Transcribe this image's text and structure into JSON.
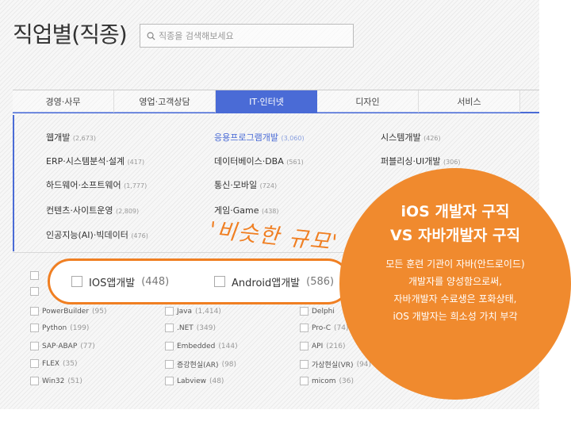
{
  "header": {
    "title": "직업별(직종)",
    "search_placeholder": "직종을 검색해보세요",
    "search_icon": "search-icon"
  },
  "tabs": [
    {
      "label": "경영·사무",
      "active": false
    },
    {
      "label": "영업·고객상담",
      "active": false
    },
    {
      "label": "IT·인터넷",
      "active": true
    },
    {
      "label": "디자인",
      "active": false
    },
    {
      "label": "서비스",
      "active": false
    }
  ],
  "categories": [
    {
      "label": "웹개발",
      "count": "(2,673)"
    },
    {
      "label": "ERP·시스템분석·설계",
      "count": "(417)"
    },
    {
      "label": "하드웨어·소프트웨어",
      "count": "(1,777)"
    },
    {
      "label": "컨텐츠·사이트운영",
      "count": "(2,809)"
    },
    {
      "label": "인공지능(AI)·빅데이터",
      "count": "(476)"
    },
    {
      "label": "응용프로그램개발",
      "count": "(3,060)"
    },
    {
      "label": "데이터베이스·DBA",
      "count": "(561)"
    },
    {
      "label": "통신·모바일",
      "count": "(724)"
    },
    {
      "label": "게임·Game",
      "count": "(438)"
    },
    {
      "label": "시스템개발",
      "count": "(426)"
    },
    {
      "label": "퍼블리싱·UI개발",
      "count": "(306)"
    }
  ],
  "skills": [
    {
      "label": "PowerBuilder",
      "count": "(95)"
    },
    {
      "label": "Python",
      "count": "(199)"
    },
    {
      "label": "SAP·ABAP",
      "count": "(77)"
    },
    {
      "label": "FLEX",
      "count": "(35)"
    },
    {
      "label": "Win32",
      "count": "(51)"
    },
    {
      "label": "Java",
      "count": "(1,414)"
    },
    {
      "label": ".NET",
      "count": "(349)"
    },
    {
      "label": "Embedded",
      "count": "(144)"
    },
    {
      "label": "증강현실(AR)",
      "count": "(98)"
    },
    {
      "label": "Labview",
      "count": "(48)"
    },
    {
      "label": "Delphi",
      "count": "(…)"
    },
    {
      "label": "Pro-C",
      "count": "(74)"
    },
    {
      "label": "API",
      "count": "(216)"
    },
    {
      "label": "가상현실(VR)",
      "count": "(94)"
    },
    {
      "label": "micom",
      "count": "(36)"
    }
  ],
  "highlight_pill": {
    "options": [
      {
        "label": "IOS앱개발",
        "count": "(448)"
      },
      {
        "label": "Android앱개발",
        "count": "(586)"
      }
    ]
  },
  "annotation": {
    "handwritten": "'비슷한 규모'"
  },
  "callout": {
    "heading_line1": "iOS 개발자 구직",
    "heading_line2": "VS 자바개발자 구직",
    "body_line1": "모든 훈련 기관이 자바(안드로이드)",
    "body_line2": "개발자를 양성함으로써,",
    "body_line3": "자바개발자 수료생은 포화상태,",
    "body_line4": "iOS 개발자는 희소성 가치 부각"
  },
  "colors": {
    "accent_blue": "#4a6bd6",
    "accent_orange": "#f07f22"
  }
}
